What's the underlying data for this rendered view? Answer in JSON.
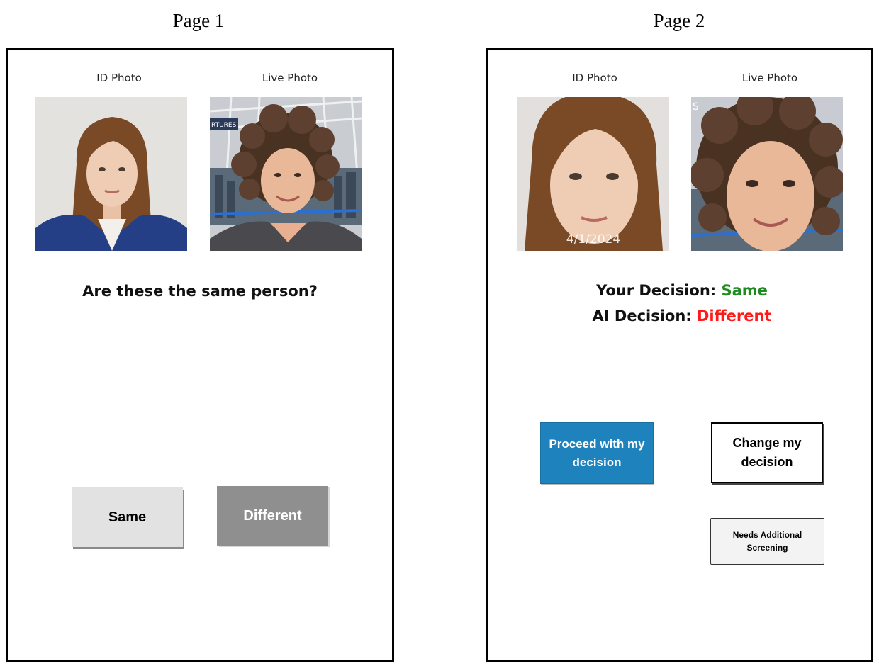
{
  "page1": {
    "caption": "Page 1",
    "id_photo_label": "ID Photo",
    "live_photo_label": "Live Photo",
    "question": "Are these the same person?",
    "same_button": "Same",
    "different_button": "Different"
  },
  "page2": {
    "caption": "Page 2",
    "id_photo_label": "ID Photo",
    "live_photo_label": "Live Photo",
    "id_photo_date": "4/1/2024",
    "your_decision_label": "Your Decision:",
    "your_decision_value": "Same",
    "ai_decision_label": "AI Decision:",
    "ai_decision_value": "Different",
    "proceed_button": "Proceed with my decision",
    "change_button": "Change my decision",
    "screening_button": "Needs Additional Screening"
  },
  "colors": {
    "your_decision_value": "#1e8b1e",
    "ai_decision_value": "#ff1a1a",
    "proceed_button_bg": "#1e82bd",
    "different_button_bg": "#8f8f8f",
    "same_button_bg": "#e2e2e2"
  }
}
